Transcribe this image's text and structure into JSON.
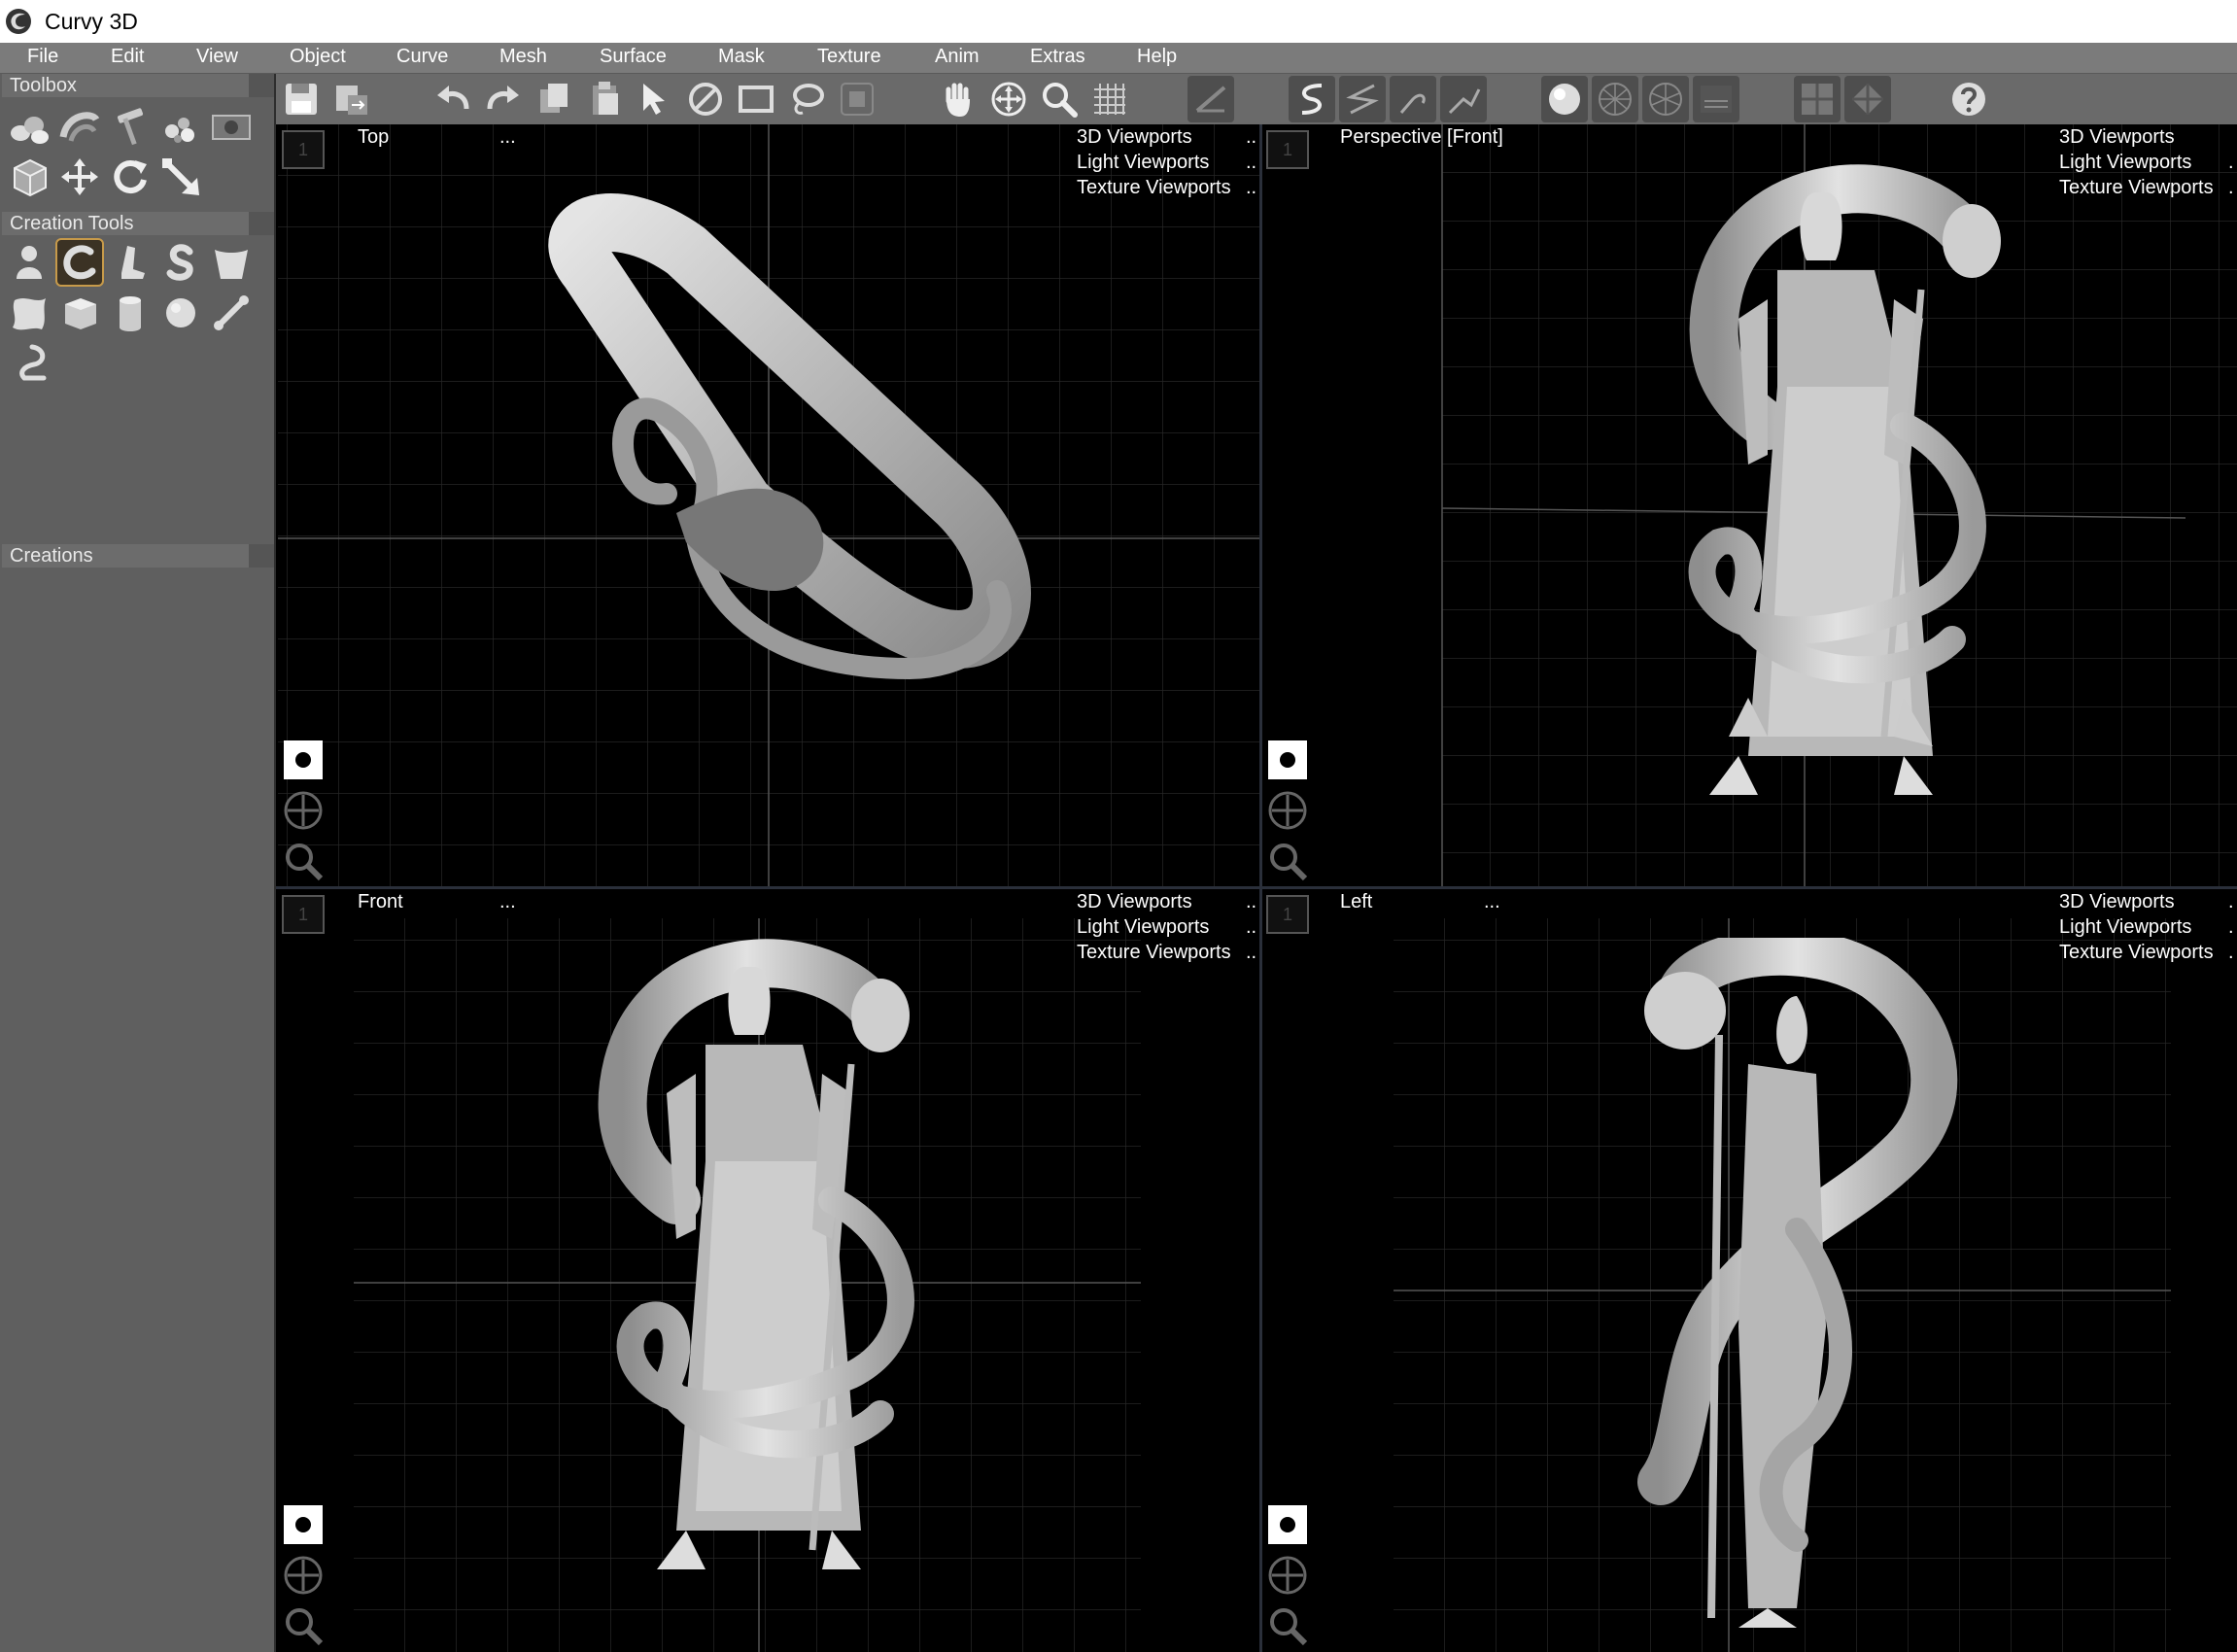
{
  "window": {
    "title": "Curvy 3D"
  },
  "menu": [
    "File",
    "Edit",
    "View",
    "Object",
    "Curve",
    "Mesh",
    "Surface",
    "Mask",
    "Texture",
    "Anim",
    "Extras",
    "Help"
  ],
  "left_panel": {
    "toolbox_header": "Toolbox",
    "creation_tools_header": "Creation Tools",
    "creations_header": "Creations",
    "toolbox_tools": [
      "objects-icon",
      "sweep-icon",
      "hammer-icon",
      "paint-blobs-icon",
      "image-plane-icon",
      "box-select-icon",
      "move-icon",
      "rotate-icon",
      "scale-icon"
    ],
    "creation_tools": [
      "blob-icon",
      "tube-icon",
      "boot-icon",
      "s-shape-icon",
      "cup-icon",
      "cloth-icon",
      "cube-icon",
      "cylinder-icon",
      "sphere-icon",
      "bone-icon",
      "hook-icon"
    ],
    "selected_creation_tool": "tube-icon"
  },
  "toolbar": {
    "buttons": [
      "save-icon",
      "export-icon",
      "undo-icon",
      "redo-icon",
      "copy-icon",
      "paste-icon",
      "select-arrow-icon",
      "deselect-icon",
      "rect-select-icon",
      "lasso-icon",
      "mask-icon",
      "pan-hand-icon",
      "move-view-icon",
      "zoom-icon",
      "grid-icon",
      "measure-icon",
      "curve-s-icon",
      "curve-z-icon",
      "curve-hook-icon",
      "curve-zigzag-icon",
      "shaded-sphere-icon",
      "wire-sphere-icon",
      "wire-sphere-2-icon",
      "curved-wires-icon",
      "quad-view-icon",
      "diamond-view-icon",
      "help-icon"
    ]
  },
  "viewports": [
    {
      "id": "top",
      "label": "Top",
      "dots": "...",
      "menu": [
        "3D Viewports",
        "Light Viewports",
        "Texture Viewports"
      ],
      "more": "..",
      "corner": "1"
    },
    {
      "id": "perspective",
      "label": "Perspective [Front]",
      "dots": "",
      "menu": [
        "3D Viewports",
        "Light Viewports",
        "Texture Viewports"
      ],
      "more": ".",
      "corner": "1"
    },
    {
      "id": "front",
      "label": "Front",
      "dots": "...",
      "menu": [
        "3D Viewports",
        "Light Viewports",
        "Texture Viewports"
      ],
      "more": "..",
      "corner": "1"
    },
    {
      "id": "left",
      "label": "Left",
      "dots": "...",
      "menu": [
        "3D Viewports",
        "Light Viewports",
        "Texture Viewports"
      ],
      "more": ".",
      "corner": "1"
    }
  ],
  "colors": {
    "menubar": "#7b7b7b",
    "panel": "#5f5f5f",
    "toolbar": "#6a6a6a",
    "viewport_bg": "#000000",
    "grid": "#2a2a2a",
    "selected_tool_border": "#c79a4a",
    "model": "#bdbdbd"
  }
}
